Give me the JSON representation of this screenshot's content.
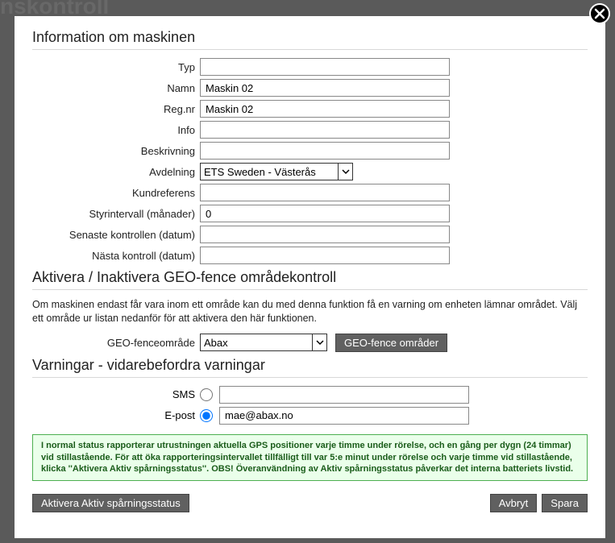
{
  "backdrop_text": "nskontroll",
  "close_label": "Close",
  "sections": {
    "machine_info": {
      "title": "Information om maskinen",
      "fields": {
        "typ": {
          "label": "Typ",
          "value": ""
        },
        "namn": {
          "label": "Namn",
          "value": "Maskin 02"
        },
        "regnr": {
          "label": "Reg.nr",
          "value": "Maskin 02"
        },
        "info": {
          "label": "Info",
          "value": ""
        },
        "beskrivning": {
          "label": "Beskrivning",
          "value": ""
        },
        "avdelning": {
          "label": "Avdelning",
          "selected": "ETS Sweden - Västerås"
        },
        "kundreferens": {
          "label": "Kundreferens",
          "value": ""
        },
        "styrintervall": {
          "label": "Styrintervall (månader)",
          "value": "0"
        },
        "senaste": {
          "label": "Senaste kontrollen (datum)",
          "value": ""
        },
        "nasta": {
          "label": "Nästa kontroll (datum)",
          "value": ""
        }
      }
    },
    "geofence": {
      "title": "Aktivera / Inaktivera GEO-fence områdekontroll",
      "description": "Om maskinen endast får vara inom ett område kan du med denna funktion få en varning om enheten lämnar området. Välj ett område ur listan nedanför för att aktivera den här funktionen.",
      "area_label": "GEO-fenceområde",
      "selected_area": "Abax",
      "areas_button": "GEO-fence områder"
    },
    "warnings": {
      "title": "Varningar - vidarebefordra varningar",
      "sms": {
        "label": "SMS",
        "value": "",
        "selected": false
      },
      "email": {
        "label": "E-post",
        "value": "mae@abax.no",
        "selected": true
      }
    }
  },
  "notice_text": "I normal status rapporterar utrustningen aktuella GPS positioner varje timme under rörelse, och en gång per dygn (24 timmar) vid stillastående. För att öka rapporteringsintervallet tillfälligt till var 5:e minut under rörelse och varje timme vid stillastående, klicka ''Aktivera Aktiv spårningsstatus''. OBS! Överanvändning av Aktiv spårningsstatus påverkar det interna batteriets livstid.",
  "buttons": {
    "activate_tracking": "Aktivera Aktiv spårningsstatus",
    "cancel": "Avbryt",
    "save": "Spara"
  }
}
